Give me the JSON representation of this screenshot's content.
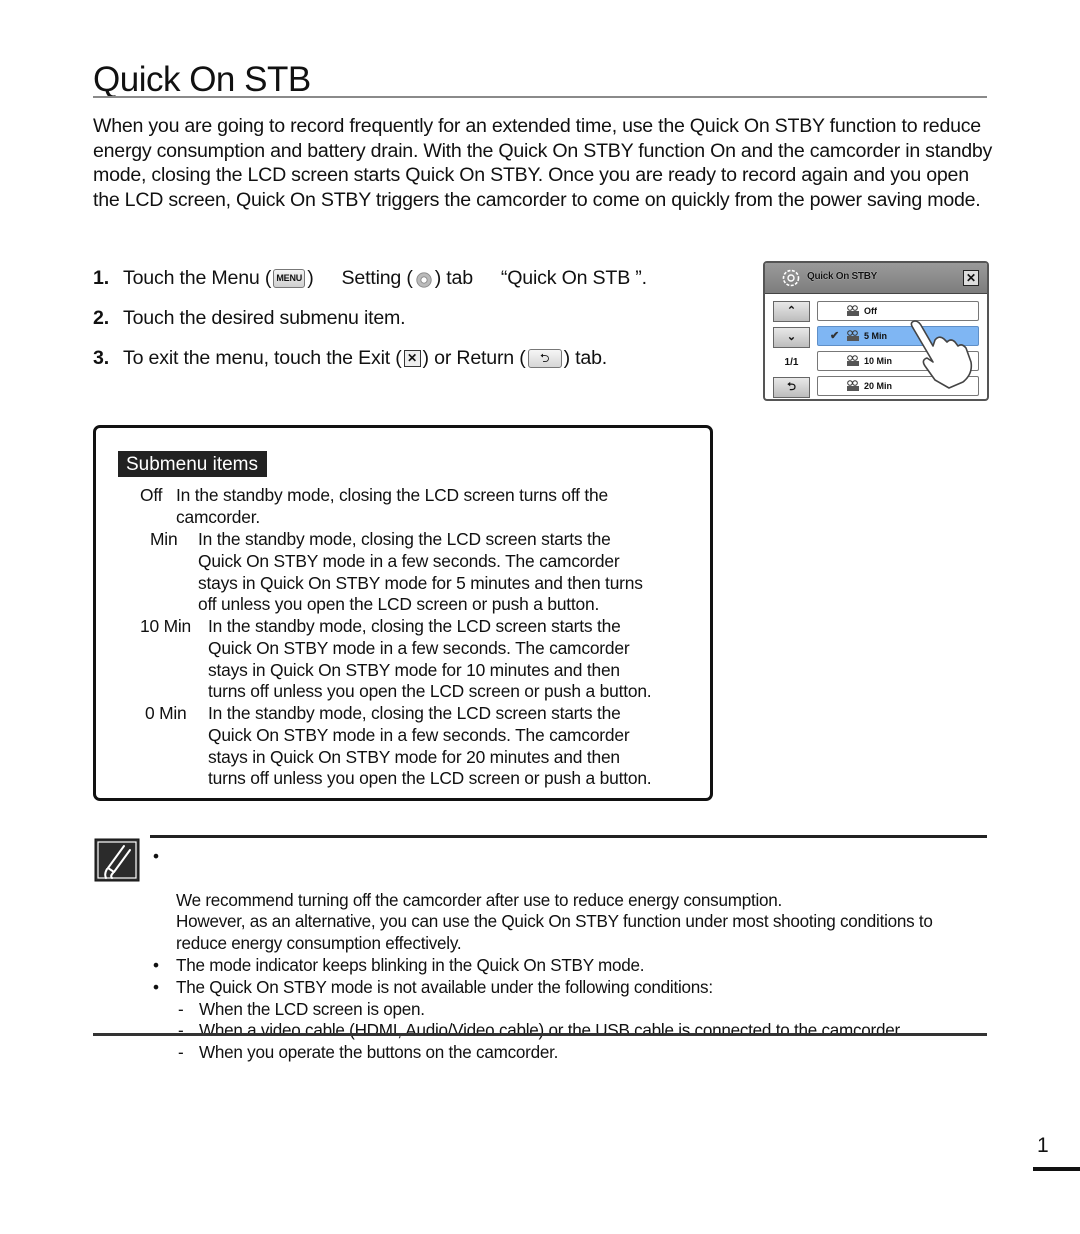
{
  "page": {
    "title": "Quick On STB",
    "intro": "When you are going to record frequently for an extended time, use the Quick On STBY function to reduce energy consumption and battery drain. With the Quick On STBY function On and the camcorder in standby mode, closing the LCD screen starts Quick On STBY. Once you are ready to record again and you open the LCD screen, Quick On STBY triggers the camcorder to come on quickly from the power saving mode.",
    "page_number": "1"
  },
  "steps": [
    {
      "num": "1.",
      "part1": "Touch the Menu (",
      "menu_icon_label": "MENU",
      "part2": ")",
      "part3": "Setting (",
      "part4": ") tab",
      "part5": "“Quick On STB ”."
    },
    {
      "num": "2.",
      "text": "Touch the desired submenu item."
    },
    {
      "num": "3.",
      "part1": "To exit the menu, touch the Exit (",
      "exit_glyph": "✕",
      "part2": ") or Return (",
      "return_glyph": "⮌",
      "part3": ") tab."
    }
  ],
  "lcd": {
    "title": "Quick On STBY",
    "close_glyph": "✕",
    "up_glyph": "⌃",
    "down_glyph": "⌄",
    "page_indicator": "1/1",
    "back_glyph": "⮌",
    "items": [
      {
        "label": "Off",
        "selected": false
      },
      {
        "label": "5 Min",
        "selected": true,
        "check": "✔"
      },
      {
        "label": "10 Min",
        "selected": false
      },
      {
        "label": "20 Min",
        "selected": false
      }
    ],
    "selected_color": "#7fb6f3"
  },
  "submenu": {
    "heading": "Submenu items",
    "items": [
      {
        "term": "Off",
        "desc": "In the standby mode, closing the LCD screen turns off the\ncamcorder."
      },
      {
        "term": "Min",
        "desc": "In the standby mode, closing the LCD screen starts the\nQuick On STBY mode in a few seconds. The camcorder\nstays in Quick On STBY mode for 5 minutes and then turns\noff unless you open the LCD screen or push a button."
      },
      {
        "term": "10 Min",
        "desc": "In the standby mode, closing the LCD screen starts the\nQuick On STBY mode in a few seconds. The camcorder\nstays in Quick On STBY mode for 10 minutes and then\nturns off unless you open the LCD screen or push a button."
      },
      {
        "term": "0 Min",
        "desc": "In the standby mode, closing the LCD screen starts the\nQuick On STBY mode in a few seconds. The camcorder\nstays in Quick On STBY mode for 20 minutes and then\nturns off unless you open the LCD screen or push a button."
      }
    ]
  },
  "notes": {
    "bullet": "•",
    "dash": "-",
    "items": [
      "We recommend turning off the camcorder after use to reduce energy consumption.\nHowever, as an alternative, you can use the Quick On STBY function under most shooting conditions to reduce energy consumption effectively.",
      "The mode indicator keeps blinking in the Quick On STBY mode.",
      "The Quick On STBY mode is not available under the following conditions:"
    ],
    "conditions": [
      "When the LCD screen is open.",
      "When a video cable (HDMI, Audio/Video cable) or the USB cable is connected to the camcorder.",
      "When you operate the buttons on the camcorder."
    ]
  }
}
